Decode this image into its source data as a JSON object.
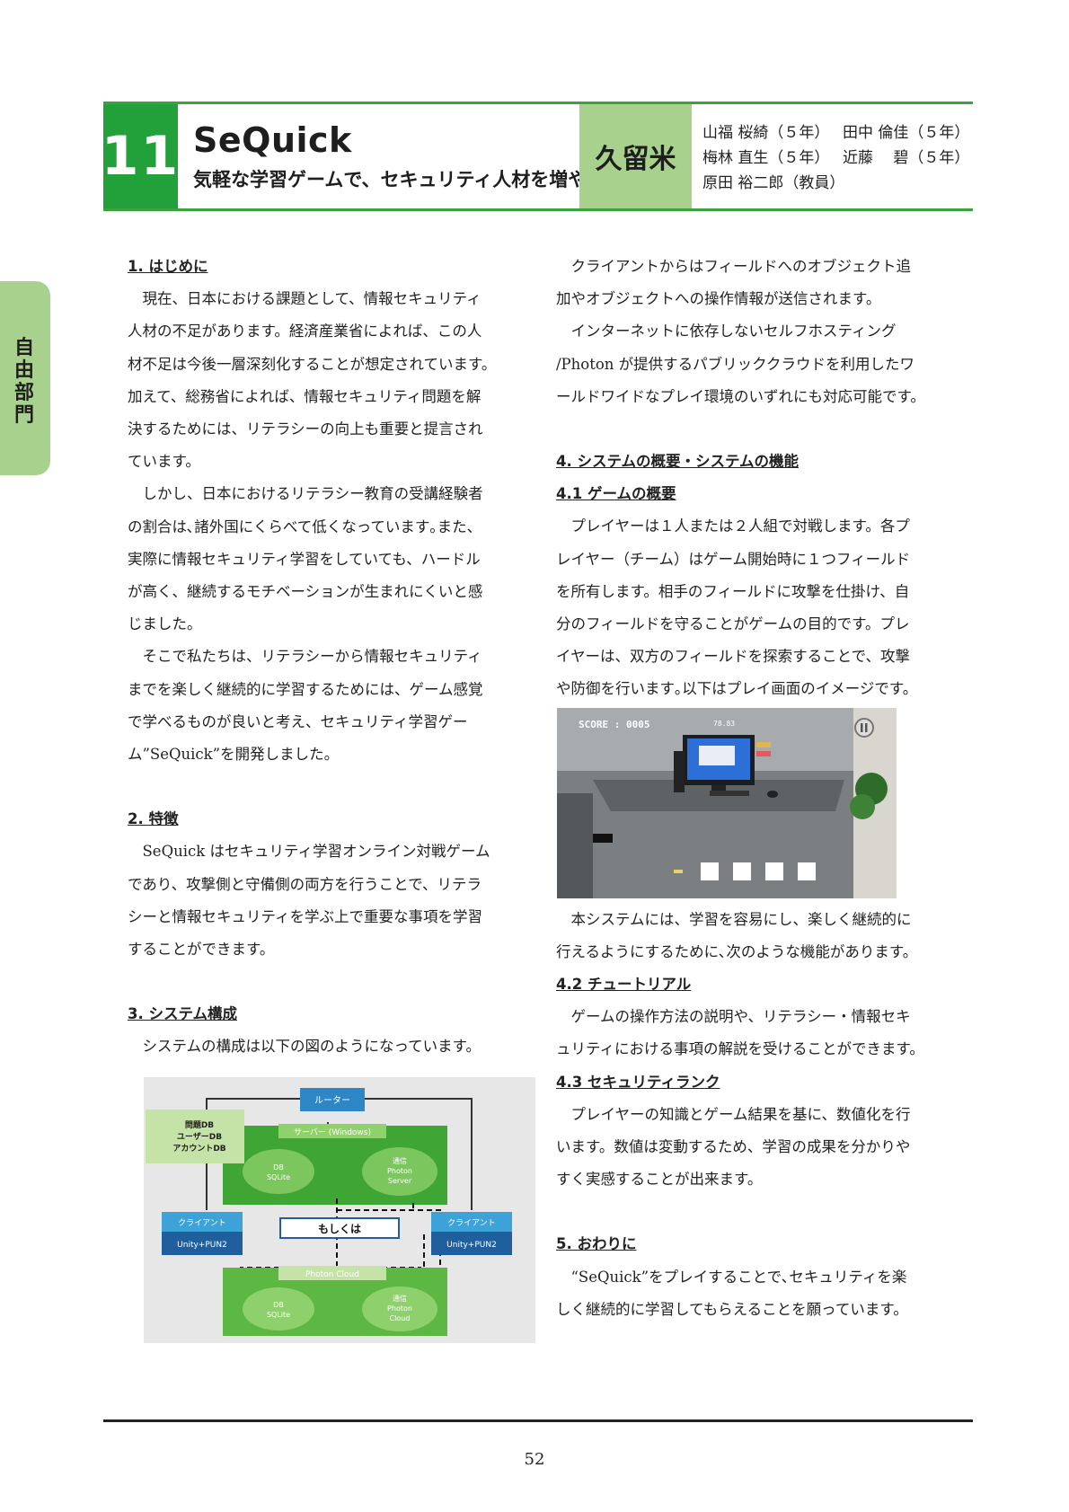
{
  "header": {
    "number": "11",
    "title": "SeQuick",
    "subtitle": "気軽な学習ゲームで、セキュリティ人材を増やそう",
    "school": "久留米",
    "authors": [
      [
        "山福 桜綺（５年）",
        "田中 倫佳（５年）"
      ],
      [
        "梅林 直生（５年）",
        "近藤　 碧（５年）"
      ],
      [
        "原田 裕二郎（教員）",
        ""
      ]
    ]
  },
  "side_tab": "自由部門",
  "left_column": {
    "h1": "1. はじめに",
    "p1": [
      "現在、日本における課題として、情報セキュリティ",
      "人材の不足があります。経済産業省によれば、この人",
      "材不足は今後一層深刻化することが想定されています。",
      "加えて、総務省によれば、情報セキュリティ問題を解",
      "決するためには、リテラシーの向上も重要と提言され",
      "ています。"
    ],
    "p2": [
      "しかし、日本におけるリテラシー教育の受講経験者",
      "の割合は､諸外国にくらべて低くなっています｡また、",
      "実際に情報セキュリティ学習をしていても、ハードル",
      "が高く、継続するモチベーションが生まれにくいと感",
      "じました。"
    ],
    "p3": [
      "そこで私たちは、リテラシーから情報セキュリティ",
      "までを楽しく継続的に学習するためには、ゲーム感覚",
      "で学べるものが良いと考え、セキュリティ学習ゲー",
      "ム”SeQuick”を開発しました。"
    ],
    "h2": "2. 特徴",
    "p4": [
      "SeQuick はセキュリティ学習オンライン対戦ゲーム",
      "であり、攻撃側と守備側の両方を行うことで、リテラ",
      "シーと情報セキュリティを学ぶ上で重要な事項を学習",
      "することができます。"
    ],
    "h3": "3. システム構成",
    "p5": [
      "システムの構成は以下の図のようになっています。"
    ]
  },
  "system_diagram": {
    "router": "ルーター",
    "db_note": [
      "問題DB",
      "ユーザーDB",
      "アカウントDB"
    ],
    "server": "サーバー (Windows)",
    "db": [
      "DB",
      "SQLite"
    ],
    "comm": [
      "通信",
      "Photon",
      "Server"
    ],
    "client_left": "クライアント",
    "client_right": "クライアント",
    "client_sub": "Unity+PUN2",
    "or": "もしくは",
    "cloud": "Photon Cloud",
    "comm_cloud": [
      "通信",
      "Photon",
      "Cloud"
    ]
  },
  "right_column": {
    "p1": [
      "クライアントからはフィールドへのオブジェクト追",
      "加やオブジェクトへの操作情報が送信されます。"
    ],
    "p2": [
      "インターネットに依存しないセルフホスティング",
      "/Photon が提供するパブリッククラウドを利用したワ",
      "ールドワイドなプレイ環境のいずれにも対応可能です。"
    ],
    "h4": "4. システムの概要・システムの機能",
    "h41": "4.1 ゲームの概要",
    "p3": [
      "プレイヤーは１人または２人組で対戦します。各プ",
      "レイヤー（チーム）はゲーム開始時に１つフィールド",
      "を所有します。相手のフィールドに攻撃を仕掛け、自",
      "分のフィールドを守ることがゲームの目的です。プレ",
      "イヤーは、双方のフィールドを探索することで、攻撃",
      "や防御を行います｡以下はプレイ画面のイメージです。"
    ],
    "p4": [
      "本システムには、学習を容易にし、楽しく継続的に",
      "行えるようにするために､次のような機能があります。"
    ],
    "h42": "4.2 チュートリアル",
    "p5": [
      "ゲームの操作方法の説明や、リテラシー・情報セキ",
      "ュリティにおける事項の解説を受けることができます。"
    ],
    "h43": "4.3 セキュリティランク",
    "p6": [
      "プレイヤーの知識とゲーム結果を基に、数値化を行",
      "います。数値は変動するため、学習の成果を分かりや",
      "すく実感することが出来ます。"
    ],
    "h5": "5. おわりに",
    "p7": [
      "“SeQuick”をプレイすることで､セキュリティを楽",
      "しく継続的に学習してもらえることを願っています。"
    ]
  },
  "game_screen": {
    "score": "SCORE : 0005",
    "timer": "78.83"
  },
  "page_number": "52"
}
